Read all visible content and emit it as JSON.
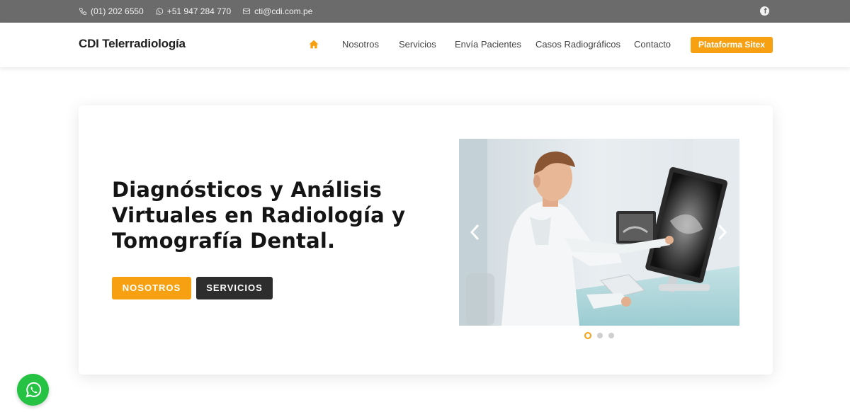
{
  "topbar": {
    "phone": "(01) 202 6550",
    "whatsapp": "+51 947 284 770",
    "email": "cti@cdi.com.pe",
    "social_icon": "facebook-icon"
  },
  "header": {
    "brand": "CDI Telerradiología",
    "nav": [
      {
        "label": "Nosotros"
      },
      {
        "label": "Servicios"
      },
      {
        "label": "Envía Pacientes"
      },
      {
        "label": "Casos Radiográficos"
      },
      {
        "label": "Contacto"
      }
    ],
    "cta": "Plataforma Sitex",
    "home_icon": "home-icon"
  },
  "hero": {
    "headline": "Diagnósticos y Análisis Virtuales en Radiología y Tomografía Dental.",
    "buttons": {
      "primary": "NOSOTROS",
      "secondary": "SERVICIOS"
    },
    "slider": {
      "image": "doctor-reviewing-dental-xray-photo",
      "slide_count": 3,
      "active_slide": 1
    }
  },
  "floating": {
    "whatsapp_icon": "whatsapp-icon"
  },
  "colors": {
    "accent": "#f7a011",
    "topbar": "#6b6b6b",
    "dark_button": "#2d2d2d",
    "whatsapp": "#25c244"
  }
}
